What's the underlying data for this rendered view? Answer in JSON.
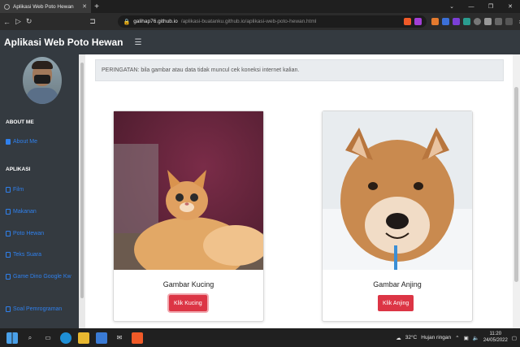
{
  "browser": {
    "tab_title": "Aplikasi Web Poto Hewan",
    "new_tab": "+",
    "url_host": "galihap76.github.io",
    "url_path": "/aplikasi-buatanku.github.io/aplikasi-web-poto-hewan.html",
    "back_icon": "arrow-left-icon",
    "forward_icon": "arrow-right-icon",
    "reload_icon": "reload-icon"
  },
  "navbar": {
    "brand": "Aplikasi Web Poto Hewan",
    "menu_icon": "hamburger-icon"
  },
  "sidebar": {
    "section_about": "ABOUT ME",
    "about_items": [
      {
        "label": "About Me",
        "active": true
      }
    ],
    "section_app": "APLIKASI",
    "app_items": [
      {
        "label": "Film"
      },
      {
        "label": "Makanan"
      },
      {
        "label": "Poto Hewan"
      },
      {
        "label": "Teks Suara"
      },
      {
        "label": "Game Dino Google Kw"
      },
      {
        "label": "Soal Pemrograman"
      }
    ]
  },
  "main": {
    "alert": "PERINGATAN: bila gambar atau data tidak muncul cek koneksi internet kalian.",
    "cards": [
      {
        "title": "Gambar Kucing",
        "button": "Klik Kucing"
      },
      {
        "title": "Gambar Anjing",
        "button": "Klik Anjing"
      }
    ]
  },
  "taskbar": {
    "weather_temp": "32°C",
    "weather_text": "Hujan ringan",
    "time": "11:20",
    "date": "24/05/2022"
  },
  "colors": {
    "navbar_bg": "#343a40",
    "link": "#2f80ed",
    "button_danger": "#dc3545"
  }
}
